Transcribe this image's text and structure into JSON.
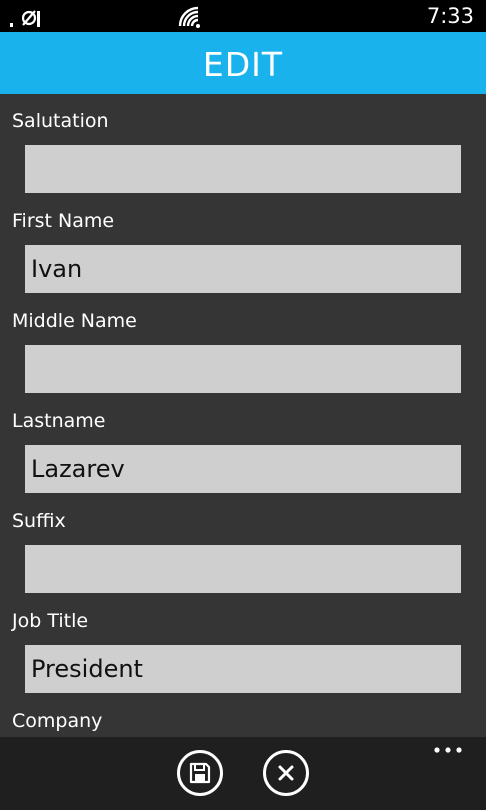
{
  "status_bar": {
    "time": "7:33",
    "signal_icon": "signal-no-sim-icon",
    "wifi_icon": "wifi-icon"
  },
  "header": {
    "title": "EDIT",
    "color": "#1ab2ed"
  },
  "form": {
    "fields": [
      {
        "label": "Salutation",
        "value": ""
      },
      {
        "label": "First Name",
        "value": "Ivan"
      },
      {
        "label": "Middle Name",
        "value": ""
      },
      {
        "label": "Lastname",
        "value": "Lazarev"
      },
      {
        "label": "Suffix",
        "value": ""
      },
      {
        "label": "Job Title",
        "value": "President"
      },
      {
        "label": "Company",
        "value": ""
      }
    ]
  },
  "appbar": {
    "save_icon": "save-icon",
    "cancel_icon": "close-icon",
    "more_icon": "more-dots-icon"
  }
}
